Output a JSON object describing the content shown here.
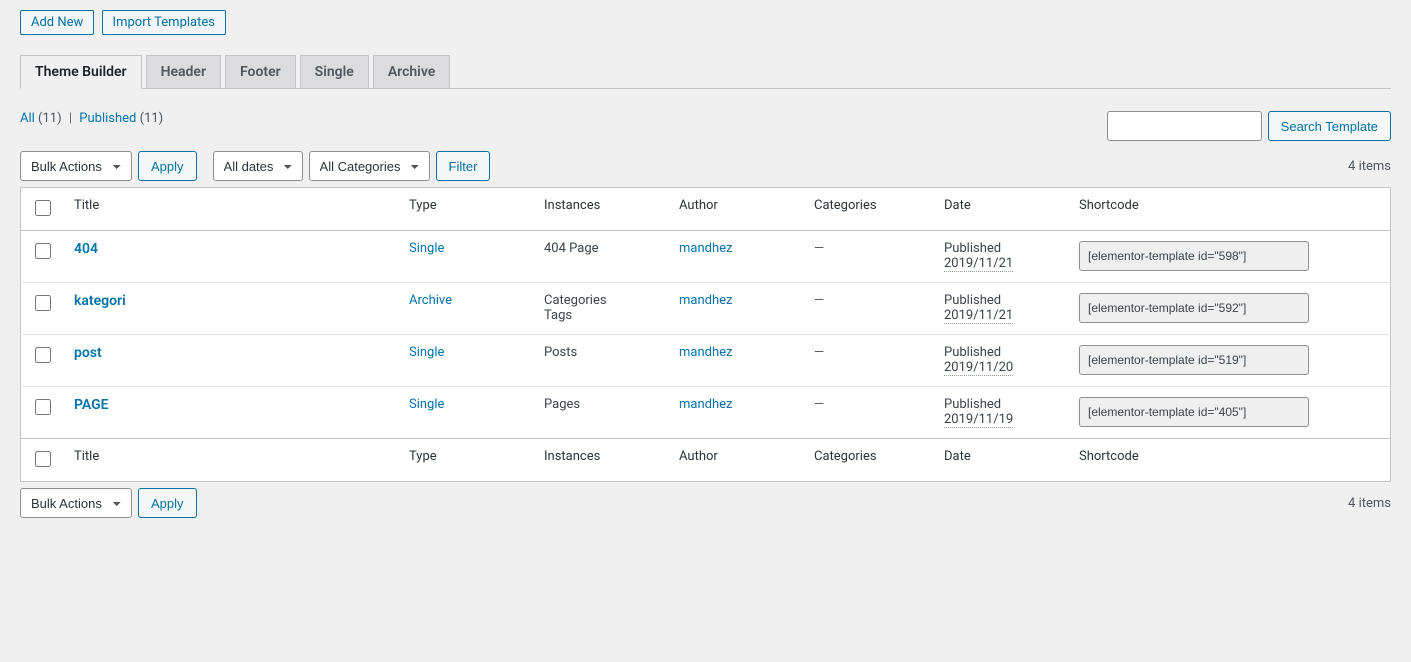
{
  "header": {
    "add_new": "Add New",
    "import": "Import Templates"
  },
  "tabs": [
    {
      "label": "Theme Builder",
      "active": true
    },
    {
      "label": "Header",
      "active": false
    },
    {
      "label": "Footer",
      "active": false
    },
    {
      "label": "Single",
      "active": false
    },
    {
      "label": "Archive",
      "active": false
    }
  ],
  "views": {
    "all_label": "All",
    "all_count": "(11)",
    "published_label": "Published",
    "published_count": "(11)"
  },
  "search": {
    "button": "Search Template"
  },
  "filters": {
    "bulk_actions": "Bulk Actions",
    "apply": "Apply",
    "all_dates": "All dates",
    "all_categories": "All Categories",
    "filter": "Filter"
  },
  "pagination": {
    "items": "4 items"
  },
  "columns": {
    "title": "Title",
    "type": "Type",
    "instances": "Instances",
    "author": "Author",
    "categories": "Categories",
    "date": "Date",
    "shortcode": "Shortcode"
  },
  "rows": [
    {
      "title": "404",
      "type": "Single",
      "instances": "404 Page",
      "author": "mandhez",
      "categories": "—",
      "status": "Published",
      "date": "2019/11/21",
      "shortcode": "[elementor-template id=\"598\"]"
    },
    {
      "title": "kategori",
      "type": "Archive",
      "instances": "Categories\nTags",
      "author": "mandhez",
      "categories": "—",
      "status": "Published",
      "date": "2019/11/21",
      "shortcode": "[elementor-template id=\"592\"]"
    },
    {
      "title": "post",
      "type": "Single",
      "instances": "Posts",
      "author": "mandhez",
      "categories": "—",
      "status": "Published",
      "date": "2019/11/20",
      "shortcode": "[elementor-template id=\"519\"]"
    },
    {
      "title": "PAGE",
      "type": "Single",
      "instances": "Pages",
      "author": "mandhez",
      "categories": "—",
      "status": "Published",
      "date": "2019/11/19",
      "shortcode": "[elementor-template id=\"405\"]"
    }
  ]
}
